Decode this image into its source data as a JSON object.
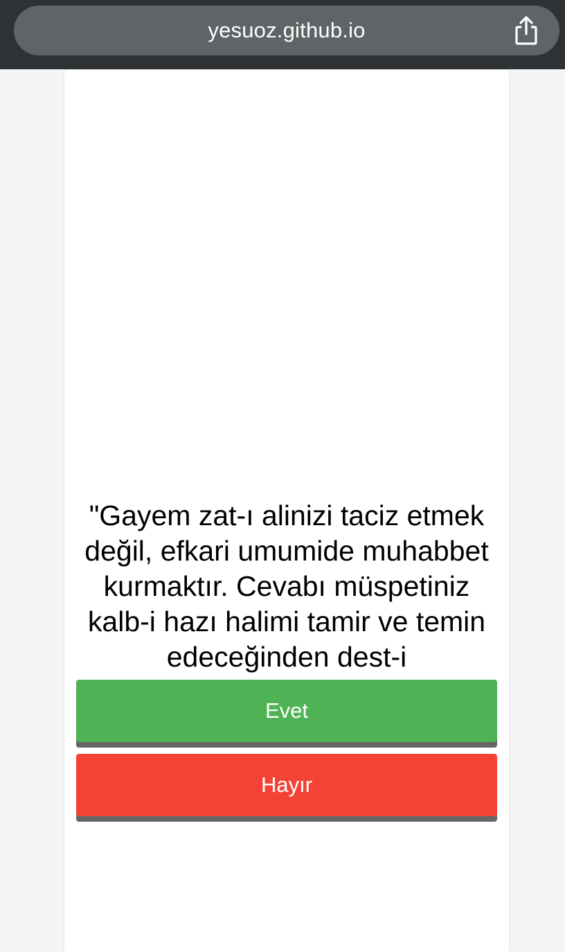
{
  "browser": {
    "url": "yesuoz.github.io",
    "share_icon": "share-icon"
  },
  "main": {
    "quote": "\"Gayem zat-ı alinizi taciz etmek\ndeğil, efkari umumide muhabbet\nkurmaktır. Cevabı müspetiniz\nkalb-i hazı halimi tamir ve temin\nedeceğinden dest-i\nmuhabbetinize talibim\" -Y.",
    "buttons": {
      "yes_label": "Evet",
      "no_label": "Hayır"
    }
  },
  "colors": {
    "yes": "#4fb254",
    "no": "#f44336",
    "topbar": "#2f3234",
    "pill": "#5f6466",
    "page_bg": "#f5f5f5"
  }
}
